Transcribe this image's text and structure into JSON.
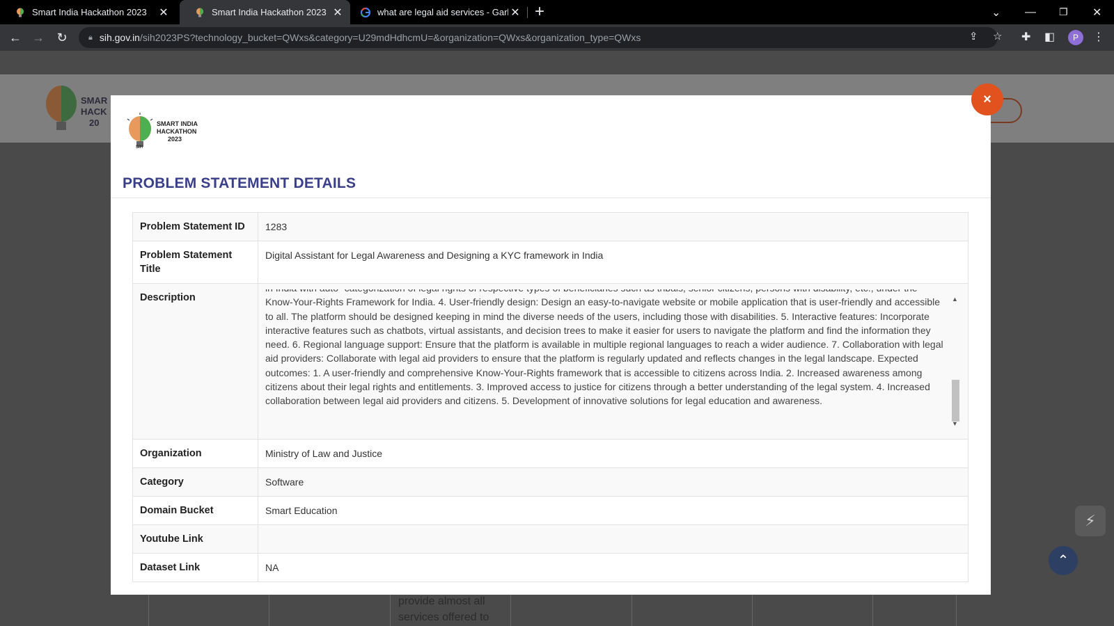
{
  "browser": {
    "tabs": [
      {
        "title": "Smart India Hackathon 2023",
        "active": false
      },
      {
        "title": "Smart India Hackathon 2023",
        "active": true
      },
      {
        "title": "what are legal aid services - Garb",
        "active": false
      }
    ],
    "url_host": "sih.gov.in",
    "url_rest": "/sih2023PS?technology_bucket=QWxs&category=U29mdHdhcmU=&organization=QWxs&organization_type=QWxs",
    "profile_initial": "P"
  },
  "background": {
    "text_line1": "provide almost all",
    "text_line2": "services offered to"
  },
  "modal": {
    "logo_line1": "SMART INDIA",
    "logo_line2": "HACKATHON",
    "logo_line3": "2023",
    "logo_badge": "SIH",
    "title": "PROBLEM STATEMENT DETAILS",
    "close_label": "×",
    "rows": [
      {
        "label": "Problem Statement ID",
        "value": "1283"
      },
      {
        "label": "Problem Statement Title",
        "value": "Digital Assistant for Legal Awareness and Designing a KYC framework in India"
      },
      {
        "label": "Description",
        "value": "in India with auto- categorization of legal rights of respective types of beneficiaries such as tribals, senior citizens, persons with disability, etc., under the Know-Your-Rights Framework for India. 4. User-friendly design: Design an easy-to-navigate website or mobile application that is user-friendly and accessible to all. The platform should be designed keeping in mind the diverse needs of the users, including those with disabilities. 5. Interactive features: Incorporate interactive features such as chatbots, virtual assistants, and decision trees to make it easier for users to navigate the platform and find the information they need. 6. Regional language support: Ensure that the platform is available in multiple regional languages to reach a wider audience. 7. Collaboration with legal aid providers: Collaborate with legal aid providers to ensure that the platform is regularly updated and reflects changes in the legal landscape. Expected outcomes: 1. A user-friendly and comprehensive Know-Your-Rights framework that is accessible to citizens across India. 2. Increased awareness among citizens about their legal rights and entitlements. 3. Improved access to justice for citizens through a better understanding of the legal system. 4. Increased collaboration between legal aid providers and citizens. 5. Development of innovative solutions for legal education and awareness."
      },
      {
        "label": "Organization",
        "value": "Ministry of Law and Justice"
      },
      {
        "label": "Category",
        "value": "Software"
      },
      {
        "label": "Domain Bucket",
        "value": "Smart Education"
      },
      {
        "label": "Youtube Link",
        "value": ""
      },
      {
        "label": "Dataset Link",
        "value": "NA"
      }
    ]
  },
  "colors": {
    "accent": "#e2521e",
    "title": "#3a3f8a"
  }
}
